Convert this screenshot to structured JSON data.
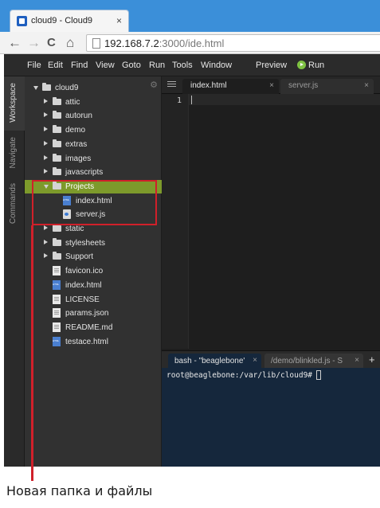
{
  "browser": {
    "tab_title": "cloud9 - Cloud9",
    "tab_close": "×",
    "url_host": "192.168.7.2",
    "url_rest": ":3000/ide.html",
    "nav": {
      "back": "←",
      "forward": "→",
      "reload": "C",
      "home": "⌂"
    }
  },
  "menubar": {
    "items": [
      "File",
      "Edit",
      "Find",
      "View",
      "Goto",
      "Run",
      "Tools",
      "Window"
    ],
    "preview": "Preview",
    "run": "Run"
  },
  "side_tabs": [
    "Workspace",
    "Navigate",
    "Commands"
  ],
  "tree": {
    "gear": "⚙",
    "items": [
      {
        "label": "cloud9",
        "kind": "folder",
        "expanded": true
      },
      {
        "label": "attic",
        "kind": "folder"
      },
      {
        "label": "autorun",
        "kind": "folder"
      },
      {
        "label": "demo",
        "kind": "folder"
      },
      {
        "label": "extras",
        "kind": "folder"
      },
      {
        "label": "images",
        "kind": "folder"
      },
      {
        "label": "javascripts",
        "kind": "folder"
      },
      {
        "label": "Projects",
        "kind": "folder",
        "expanded": true,
        "selected": true
      },
      {
        "label": "index.html",
        "kind": "html"
      },
      {
        "label": "server.js",
        "kind": "js"
      },
      {
        "label": "static",
        "kind": "folder"
      },
      {
        "label": "stylesheets",
        "kind": "folder"
      },
      {
        "label": "Support",
        "kind": "folder"
      },
      {
        "label": "favicon.ico",
        "kind": "doc"
      },
      {
        "label": "index.html",
        "kind": "html"
      },
      {
        "label": "LICENSE",
        "kind": "doc"
      },
      {
        "label": "params.json",
        "kind": "doc"
      },
      {
        "label": "README.md",
        "kind": "doc"
      },
      {
        "label": "testace.html",
        "kind": "html"
      }
    ]
  },
  "editor": {
    "tabs": [
      {
        "label": "index.html",
        "close": "×",
        "active": true
      },
      {
        "label": "server.js",
        "close": "×",
        "active": false
      }
    ],
    "line_number": "1"
  },
  "terminal": {
    "tabs": [
      {
        "label": "bash - \"beaglebone'",
        "close": "×",
        "active": true
      },
      {
        "label": "/demo/blinkled.js - S",
        "close": "×",
        "active": false
      }
    ],
    "plus": "+",
    "prompt": "root@beaglebone:/var/lib/cloud9#"
  },
  "annotation": {
    "caption": "Новая папка и файлы",
    "color": "#d0202a"
  },
  "colors": {
    "selection": "#7d9a2b",
    "terminal_bg": "#15273c",
    "browser_frame": "#3b8fd9"
  }
}
